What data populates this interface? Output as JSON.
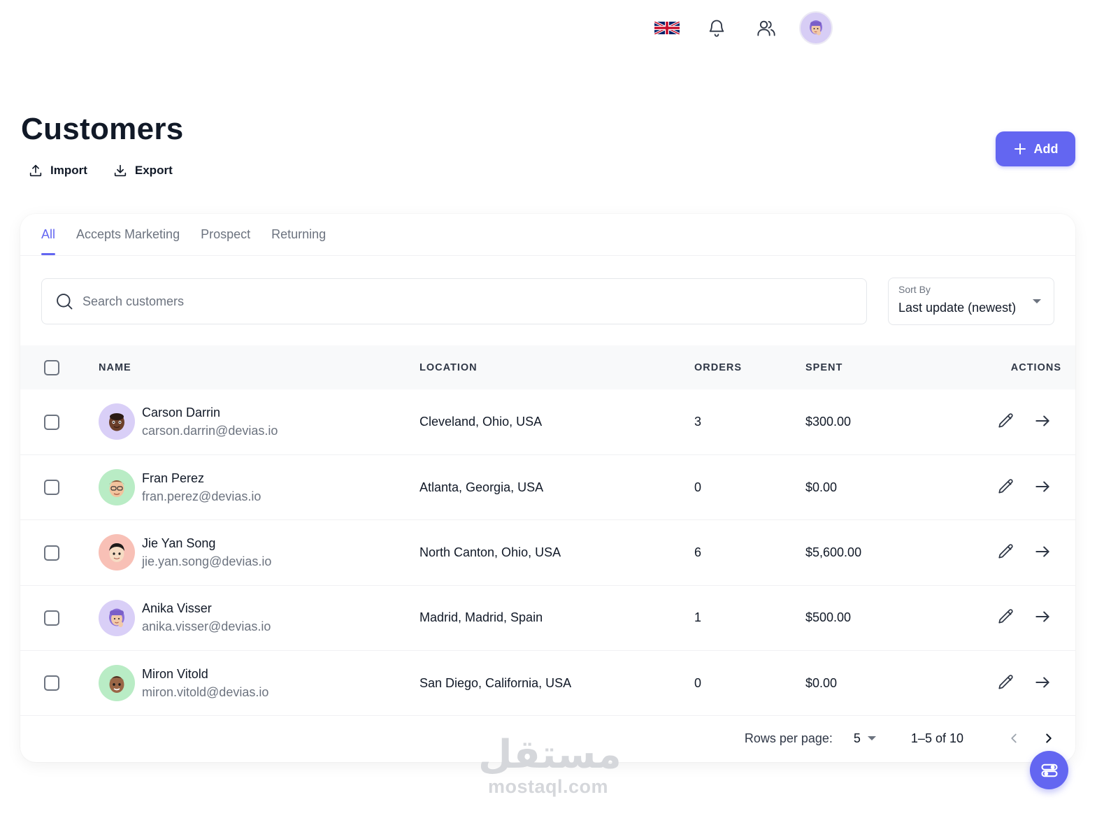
{
  "topbar": {
    "language_icon": "uk-flag-icon",
    "notifications_icon": "bell-icon",
    "contacts_icon": "users-icon",
    "account_avatar_icon": "avatar-memoji"
  },
  "header": {
    "title": "Customers",
    "import_label": "Import",
    "export_label": "Export",
    "add_label": "Add"
  },
  "tabs": [
    {
      "label": "All",
      "active": true
    },
    {
      "label": "Accepts Marketing",
      "active": false
    },
    {
      "label": "Prospect",
      "active": false
    },
    {
      "label": "Returning",
      "active": false
    }
  ],
  "search": {
    "placeholder": "Search customers",
    "value": ""
  },
  "sort": {
    "label": "Sort By",
    "value": "Last update (newest)"
  },
  "table": {
    "columns": [
      "NAME",
      "LOCATION",
      "ORDERS",
      "SPENT",
      "ACTIONS"
    ],
    "rows": [
      {
        "name": "Carson Darrin",
        "email": "carson.darrin@devias.io",
        "location": "Cleveland, Ohio, USA",
        "orders": "3",
        "spent": "$300.00",
        "avatar_bg": "#d9cff7"
      },
      {
        "name": "Fran Perez",
        "email": "fran.perez@devias.io",
        "location": "Atlanta, Georgia, USA",
        "orders": "0",
        "spent": "$0.00",
        "avatar_bg": "#b9ecc5"
      },
      {
        "name": "Jie Yan Song",
        "email": "jie.yan.song@devias.io",
        "location": "North Canton, Ohio, USA",
        "orders": "6",
        "spent": "$5,600.00",
        "avatar_bg": "#f8c0b6"
      },
      {
        "name": "Anika Visser",
        "email": "anika.visser@devias.io",
        "location": "Madrid, Madrid, Spain",
        "orders": "1",
        "spent": "$500.00",
        "avatar_bg": "#d9cff7"
      },
      {
        "name": "Miron Vitold",
        "email": "miron.vitold@devias.io",
        "location": "San Diego, California, USA",
        "orders": "0",
        "spent": "$0.00",
        "avatar_bg": "#b9ecc5"
      }
    ]
  },
  "pagination": {
    "rows_per_page_label": "Rows per page:",
    "rows_per_page": "5",
    "range": "1–5 of 10"
  },
  "watermark": {
    "arabic": "مستقل",
    "latin": "mostaql.com"
  },
  "colors": {
    "primary": "#6366f1",
    "text": "#111927",
    "muted": "#6c737f"
  }
}
